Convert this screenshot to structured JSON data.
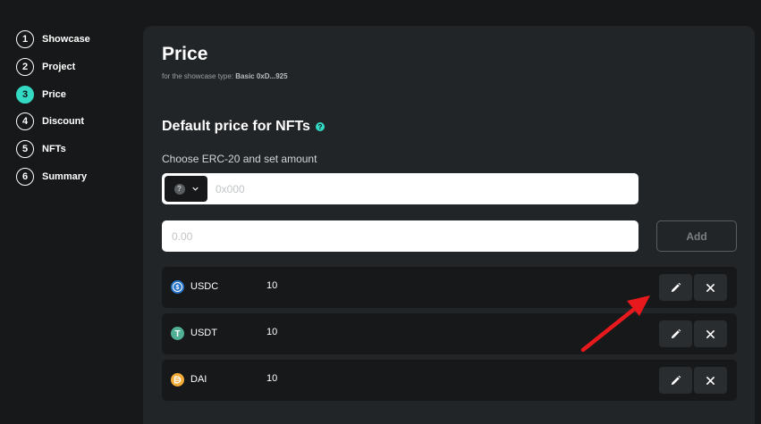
{
  "stepper": {
    "steps": [
      {
        "num": "1",
        "label": "Showcase"
      },
      {
        "num": "2",
        "label": "Project"
      },
      {
        "num": "3",
        "label": "Price",
        "active": true
      },
      {
        "num": "4",
        "label": "Discount"
      },
      {
        "num": "5",
        "label": "NFTs"
      },
      {
        "num": "6",
        "label": "Summary"
      }
    ]
  },
  "page": {
    "title": "Price",
    "subtitle_prefix": "for the showcase type:",
    "showcase_type": "Basic 0xD...925"
  },
  "default_price": {
    "title": "Default price for NFTs",
    "help_icon": "?",
    "field_label": "Choose ERC-20 and set amount",
    "token_select_badge": "?",
    "address_placeholder": "0x000",
    "amount_placeholder": "0.00",
    "add_label": "Add"
  },
  "prices": [
    {
      "symbol": "USDC",
      "amount": "10",
      "icon": "usdc-icon",
      "color": "#2775ca"
    },
    {
      "symbol": "USDT",
      "amount": "10",
      "icon": "usdt-icon",
      "color": "#50af95"
    },
    {
      "symbol": "DAI",
      "amount": "10",
      "icon": "dai-icon",
      "color": "#f5ac37"
    }
  ],
  "colors": {
    "accent": "#34d9c3",
    "annotation_arrow": "#e8191c"
  }
}
